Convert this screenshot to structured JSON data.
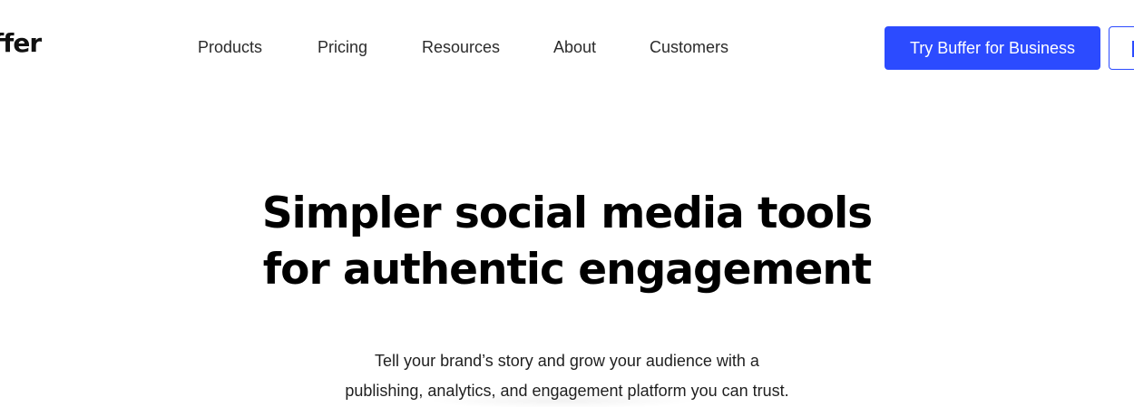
{
  "header": {
    "logo_text": "ffer",
    "nav": [
      {
        "label": "Products"
      },
      {
        "label": "Pricing"
      },
      {
        "label": "Resources"
      },
      {
        "label": "About"
      },
      {
        "label": "Customers"
      }
    ],
    "cta_primary": "Try Buffer for Business",
    "cta_secondary": ""
  },
  "hero": {
    "headline_line1": "Simpler social media tools",
    "headline_line2": "for authentic engagement",
    "subtext_line1": "Tell your brand’s story and grow your audience with a",
    "subtext_line2": "publishing, analytics, and engagement platform you can trust."
  },
  "colors": {
    "accent": "#2c4bff",
    "text": "#1f1f1f",
    "background": "#ffffff"
  }
}
